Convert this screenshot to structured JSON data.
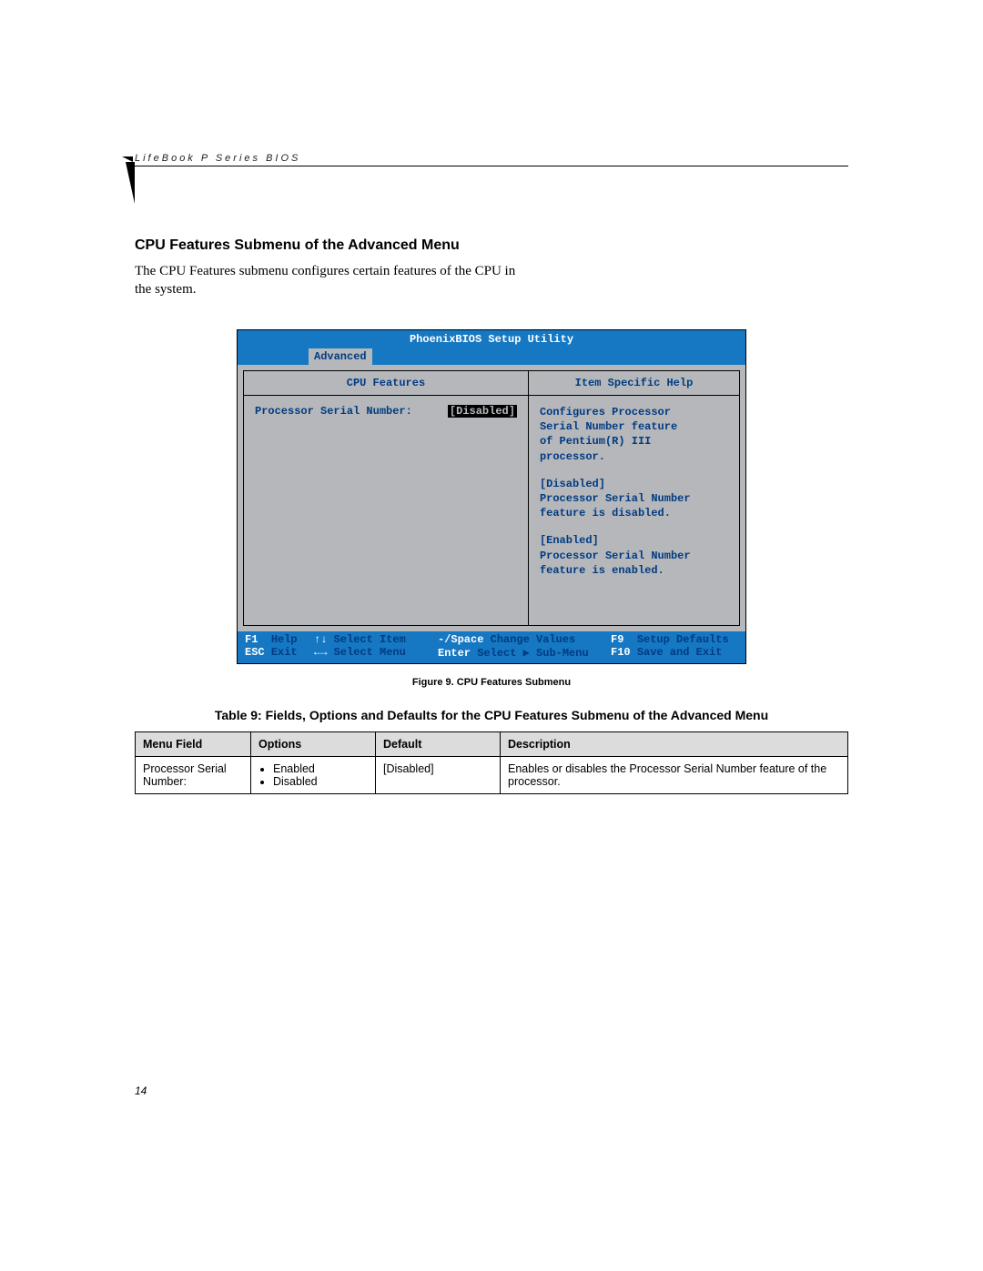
{
  "header": {
    "running_head": "LifeBook P Series BIOS"
  },
  "section": {
    "title": "CPU Features Submenu of the Advanced Menu",
    "body": "The CPU Features submenu configures certain features of the CPU in the system."
  },
  "bios": {
    "title": "PhoenixBIOS Setup Utility",
    "tab": "Advanced",
    "left_panel_title": "CPU Features",
    "right_panel_title": "Item Specific Help",
    "field_label": "Processor Serial Number:",
    "field_value": "[Disabled]",
    "help_lines": [
      "Configures Processor",
      "Serial Number feature",
      "of Pentium(R) III",
      "processor."
    ],
    "help_disabled_title": "[Disabled]",
    "help_disabled_lines": [
      "Processor Serial Number",
      "feature is disabled."
    ],
    "help_enabled_title": "[Enabled]",
    "help_enabled_lines": [
      "Processor Serial Number",
      "feature is enabled."
    ],
    "footer": {
      "r1c1k": "F1",
      "r1c1t": "Help",
      "r1c2k": "↑↓",
      "r1c2t": "Select Item",
      "r1c3k": "-/Space",
      "r1c3t": "Change Values",
      "r1c4k": "F9",
      "r1c4t": "Setup Defaults",
      "r2c1k": "ESC",
      "r2c1t": "Exit",
      "r2c2k": "←→",
      "r2c2t": "Select Menu",
      "r2c3k": "Enter",
      "r2c3t": "Select ▶ Sub-Menu",
      "r2c4k": "F10",
      "r2c4t": "Save and Exit"
    }
  },
  "figure_caption": "Figure 9.  CPU Features Submenu",
  "table": {
    "title": "Table 9: Fields, Options and Defaults for the CPU Features Submenu of the Advanced Menu",
    "headers": {
      "menu": "Menu Field",
      "options": "Options",
      "def": "Default",
      "desc": "Description"
    },
    "row": {
      "menu": "Processor Serial Number:",
      "opt1": "Enabled",
      "opt2": "Disabled",
      "def": "[Disabled]",
      "desc": "Enables or disables the Processor Serial Number feature of the processor."
    }
  },
  "page_number": "14"
}
